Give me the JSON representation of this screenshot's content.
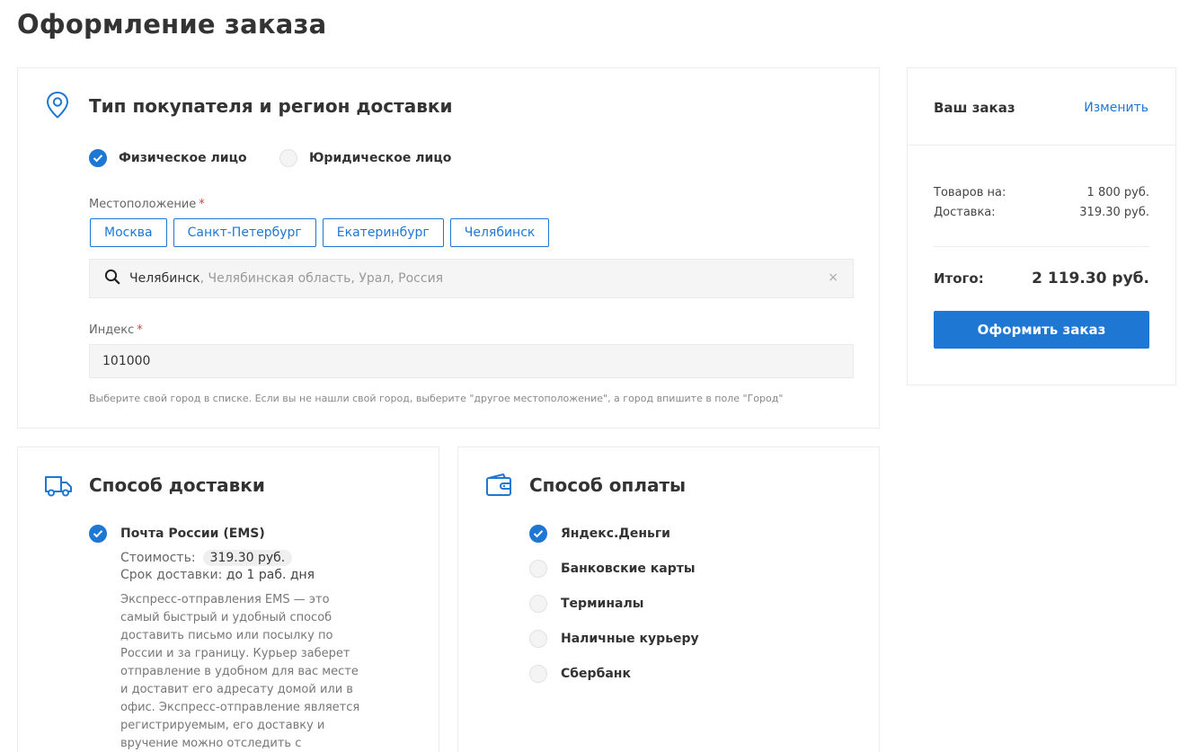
{
  "page": {
    "title": "Оформление заказа"
  },
  "buyer": {
    "title": "Тип покупателя и регион доставки",
    "types": [
      {
        "label": "Физическое лицо",
        "checked": true
      },
      {
        "label": "Юридическое лицо",
        "checked": false
      }
    ],
    "location_label": "Местоположение",
    "required_mark": "*",
    "cities": [
      "Москва",
      "Санкт-Петербург",
      "Екатеринбург",
      "Челябинск"
    ],
    "location_value": "Челябинск",
    "location_extra": ", Челябинская область, Урал, Россия",
    "clear_symbol": "×",
    "index_label": "Индекс",
    "index_value": "101000",
    "hint": "Выберите свой город в списке. Если вы не нашли свой город, выберите \"другое местоположение\", а город впишите в поле \"Город\""
  },
  "delivery": {
    "title": "Способ доставки",
    "option": {
      "label": "Почта России (EMS)",
      "checked": true
    },
    "cost_label": "Стоимость:",
    "cost_value": "319.30 руб.",
    "term_label": "Срок доставки:",
    "term_value": "до 1 раб. дня",
    "description": "Экспресс-отправления EMS — это самый быстрый и удобный способ доставить письмо или посылку по России и за границу. Курьер заберет отправление в удобном для вас месте и доставит его адресату домой или в офис. Экспресс-отправление является регистрируемым, его доставку и вручение можно отследить с помощью трек-номера. В"
  },
  "payment": {
    "title": "Способ оплаты",
    "options": [
      {
        "label": "Яндекс.Деньги",
        "checked": true
      },
      {
        "label": "Банковские карты",
        "checked": false
      },
      {
        "label": "Терминалы",
        "checked": false
      },
      {
        "label": "Наличные курьеру",
        "checked": false
      },
      {
        "label": "Сбербанк",
        "checked": false
      }
    ]
  },
  "order": {
    "title": "Ваш заказ",
    "change_label": "Изменить",
    "goods_label": "Товаров на:",
    "goods_value": "1 800 руб.",
    "delivery_label": "Доставка:",
    "delivery_value": "319.30 руб.",
    "total_label": "Итого:",
    "total_value": "2 119.30 руб.",
    "checkout_label": "Оформить заказ"
  },
  "colors": {
    "accent": "#1f77d4",
    "required": "#e0403a"
  },
  "icons": {
    "buyer": "map-pin-icon",
    "delivery": "truck-icon",
    "payment": "wallet-icon",
    "search": "search-icon",
    "check": "check-icon"
  }
}
